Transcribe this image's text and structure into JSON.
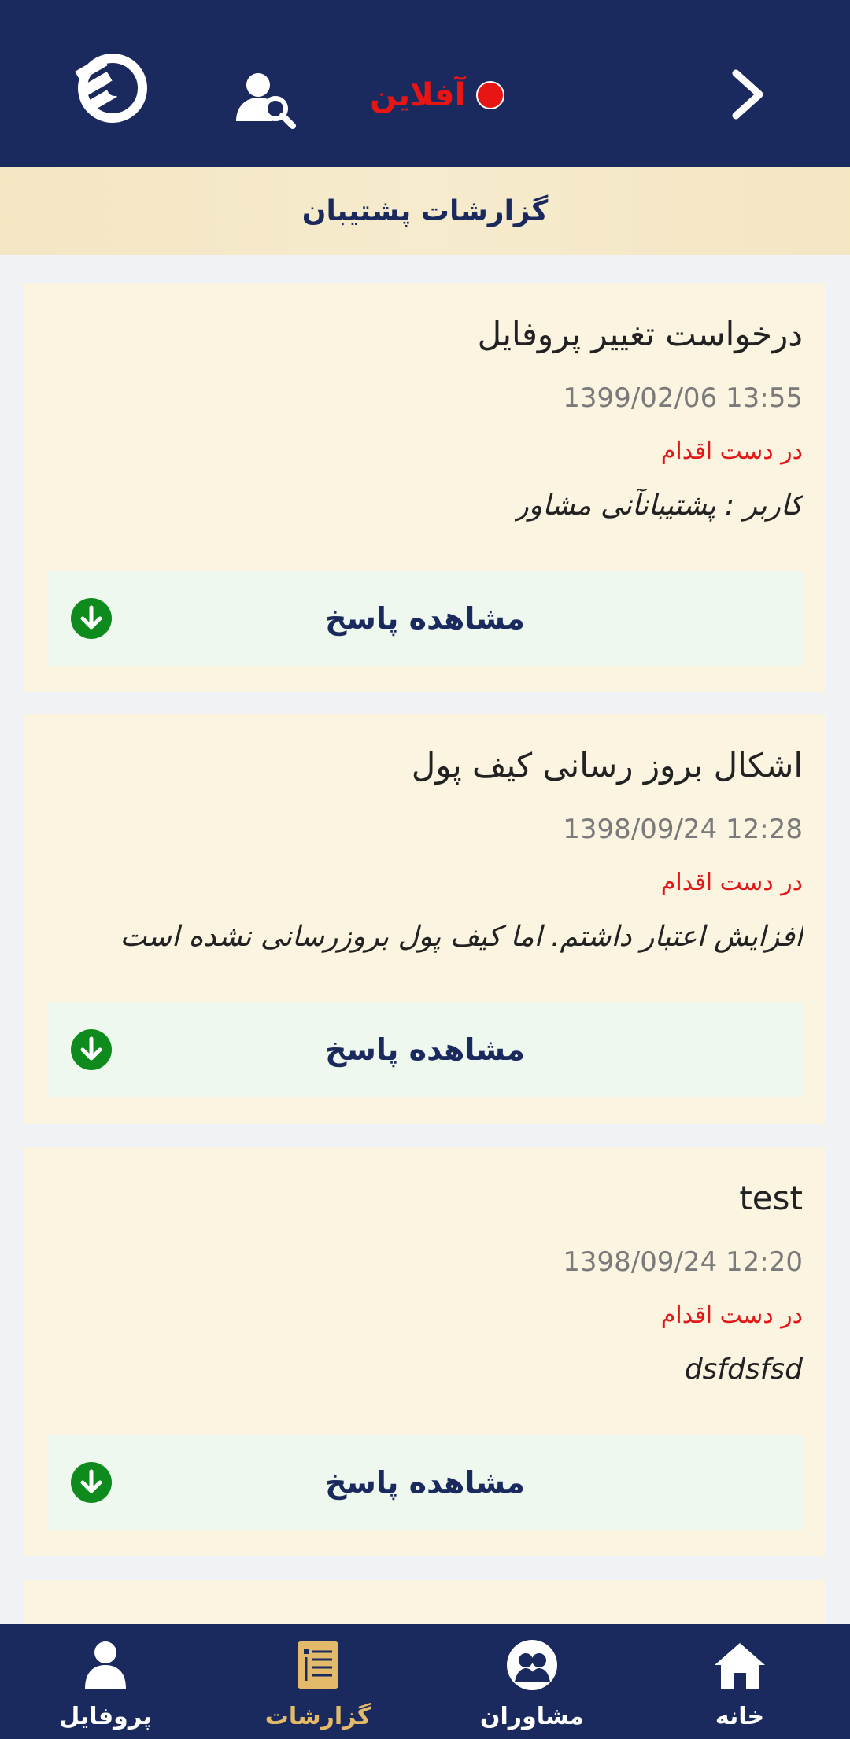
{
  "header": {
    "status_text": "آفلاین",
    "colors": {
      "bar": "#1b2a5e",
      "status": "#e81515"
    },
    "icons": [
      "chevron-right-icon",
      "status-dot-icon",
      "user-search-icon",
      "app-logo-icon"
    ]
  },
  "page": {
    "title": "گزارشات پشتیبان"
  },
  "reports": [
    {
      "title": "درخواست تغییر پروفایل",
      "date": "1399/02/06 13:55",
      "status": "در دست اقدام",
      "body": "کاربر : پشتیبانآنی مشاور",
      "action": "مشاهده پاسخ"
    },
    {
      "title": "اشکال بروز رسانی کیف پول",
      "date": "1398/09/24 12:28",
      "status": "در دست اقدام",
      "body": "افزایش اعتبار داشتم. اما کیف پول بروزرسانی نشده است",
      "action": "مشاهده پاسخ"
    },
    {
      "title": "test",
      "date": "1398/09/24 12:20",
      "status": "در دست اقدام",
      "body": "dsfdsfsd",
      "action": "مشاهده پاسخ"
    }
  ],
  "bottom_nav": {
    "items": [
      {
        "label": "پروفایل",
        "icon": "profile-icon",
        "active": false
      },
      {
        "label": "گزارشات",
        "icon": "reports-icon",
        "active": true
      },
      {
        "label": "مشاوران",
        "icon": "advisors-icon",
        "active": false
      },
      {
        "label": "خانه",
        "icon": "home-icon",
        "active": false
      }
    ],
    "active_color": "#e3b96a"
  }
}
